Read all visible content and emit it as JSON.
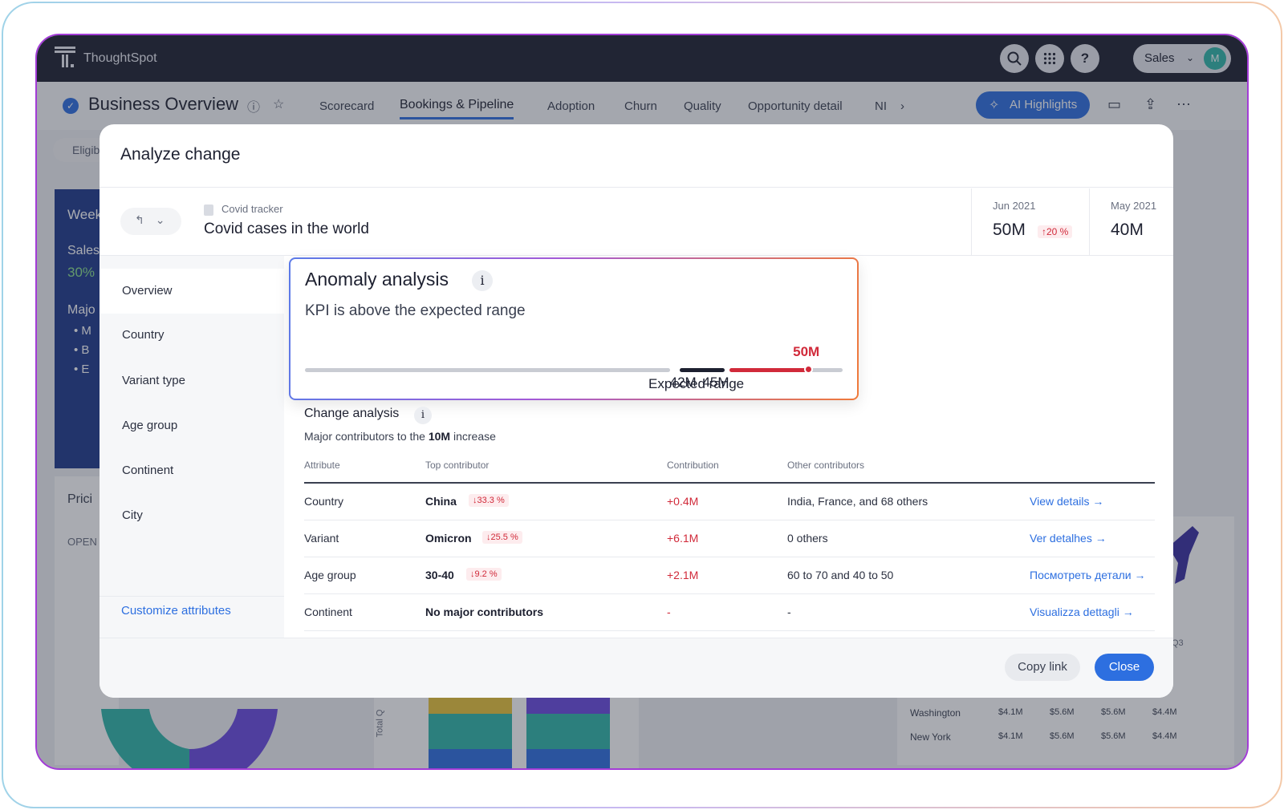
{
  "app": {
    "name": "ThoughtSpot",
    "user_menu": "Sales",
    "avatar_initial": "M"
  },
  "page": {
    "title": "Business Overview",
    "tabs": [
      "Scorecard",
      "Bookings & Pipeline",
      "Adoption",
      "Churn",
      "Quality",
      "Opportunity detail",
      "NI"
    ],
    "active_tab": "Bookings & Pipeline",
    "ai_highlights_label": "AI Highlights"
  },
  "background": {
    "filter_chip": "Eligib",
    "card_title": "Week",
    "sales": "Sales",
    "sales_pct": "30%",
    "major": "Majo",
    "bullets": [
      "M",
      "B",
      "E"
    ],
    "pricing": "Prici",
    "open": "OPEN",
    "table_rows": [
      {
        "label": "Washington",
        "values": [
          "$4.1M",
          "$5.6M",
          "$5.6M",
          "$4.4M"
        ]
      },
      {
        "label": "New York",
        "values": [
          "$4.1M",
          "$5.6M",
          "$5.6M",
          "$4.4M"
        ]
      }
    ],
    "q3": "Q3",
    "total_q": "Total Q"
  },
  "modal": {
    "title": "Analyze change",
    "breadcrumb": "Covid tracker",
    "kpi_name": "Covid cases in the world",
    "current": {
      "date": "Jun 2021",
      "value": "50M",
      "change": "↑20 %"
    },
    "previous": {
      "date": "May 2021",
      "value": "40M"
    },
    "nav": [
      "Overview",
      "Country",
      "Variant type",
      "Age group",
      "Continent",
      "City"
    ],
    "active_nav": "Overview",
    "customize_label": "Customize attributes",
    "anomaly": {
      "title": "Anomaly analysis",
      "info": "i",
      "subtitle": "KPI is above the expected range",
      "range_low": "42M",
      "range_high": "45M",
      "range_label": "Expected range",
      "actual_label": "50M",
      "range_low_value": 42,
      "range_high_value": 45,
      "actual_value": 50,
      "scale_min": 20,
      "scale_max": 52
    },
    "change_analysis": {
      "title": "Change analysis",
      "info": "i",
      "subtitle_prefix": "Major contributors to the ",
      "subtitle_bold": "10M",
      "subtitle_suffix": " increase",
      "columns": [
        "Attribute",
        "Top contributor",
        "Contribution",
        "Other contributors"
      ],
      "rows": [
        {
          "attribute": "Country",
          "top": "China",
          "pct": "↓33.3 %",
          "contribution": "+0.4M",
          "others": "India, France, and 68 others",
          "link": "View details →"
        },
        {
          "attribute": "Variant",
          "top": "Omicron",
          "pct": "↓25.5 %",
          "contribution": "+6.1M",
          "others": "0 others",
          "link": "Ver detalhes →"
        },
        {
          "attribute": "Age group",
          "top": "30-40",
          "pct": "↓9.2 %",
          "contribution": "+2.1M",
          "others": "60 to 70 and 40 to 50",
          "link": "Посмотреть детали →"
        },
        {
          "attribute": "Continent",
          "top": "No major contributors",
          "pct": "",
          "contribution": "-",
          "others": "-",
          "link": "Visualizza dettagli →"
        }
      ]
    },
    "copy_link_label": "Copy link",
    "close_label": "Close"
  },
  "colors": {
    "accent": "#2d6fe0",
    "alert": "#d12a3a",
    "topbar": "#1d2030"
  }
}
